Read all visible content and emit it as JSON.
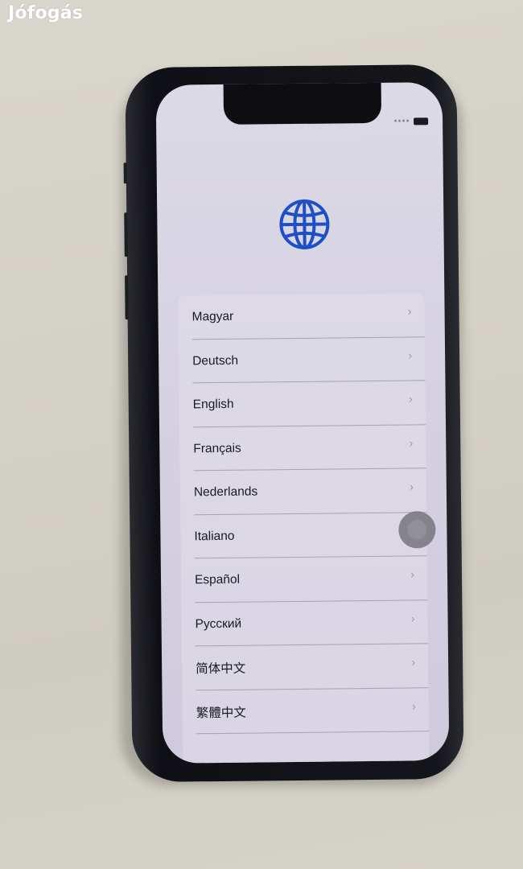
{
  "watermark": "Jófogás",
  "screen": {
    "title_icon": "globe-icon",
    "accent_color": "#1f4fc4",
    "languages": [
      {
        "label": "Magyar"
      },
      {
        "label": "Deutsch"
      },
      {
        "label": "English"
      },
      {
        "label": "Français"
      },
      {
        "label": "Nederlands"
      },
      {
        "label": "Italiano"
      },
      {
        "label": "Español"
      },
      {
        "label": "Русский"
      },
      {
        "label": "简体中文"
      },
      {
        "label": "繁體中文"
      }
    ],
    "chevron_glyph": "›"
  }
}
